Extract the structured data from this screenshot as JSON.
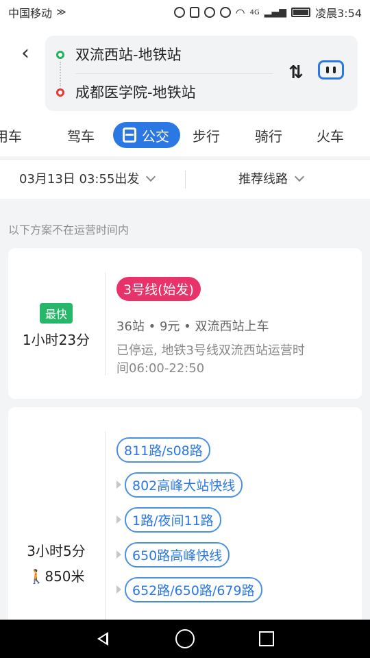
{
  "status_bar": {
    "carrier": "中国移动",
    "network": "4G",
    "time": "凌晨3:54"
  },
  "route": {
    "start": "双流西站-地铁站",
    "end": "成都医学院-地铁站"
  },
  "tabs": [
    {
      "label": "用车"
    },
    {
      "label": "驾车"
    },
    {
      "label": "公交",
      "active": true
    },
    {
      "label": "步行"
    },
    {
      "label": "骑行"
    },
    {
      "label": "火车"
    }
  ],
  "filter": {
    "departure": "03月13日 03:55出发",
    "strategy": "推荐线路"
  },
  "notice": "以下方案不在运营时间内",
  "plans": [
    {
      "badge": "最快",
      "duration": "1小时23分",
      "line": "3号线(始发)",
      "meta": "36站 • 9元 • 双流西站上车",
      "note_line1": "已停运, 地铁3号线双流西站运营时",
      "note_line2": "间06:00-22:50"
    },
    {
      "duration": "3小时5分",
      "walk": "850米",
      "routes": [
        "811路/s08路",
        "802高峰大站快线",
        "1路/夜间11路",
        "650路高峰快线",
        "652路/650路/679路"
      ]
    }
  ],
  "colors": {
    "accent": "#2b78e4",
    "line_red": "#e8336a",
    "fast_green": "#26b76a"
  }
}
